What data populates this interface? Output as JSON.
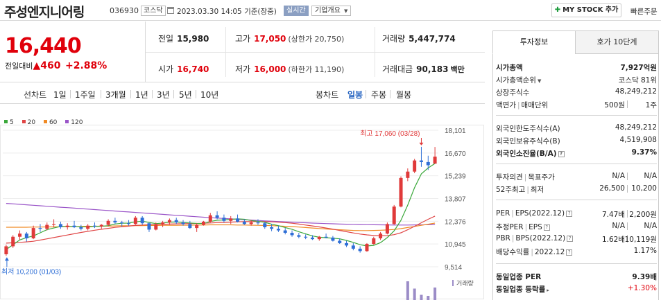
{
  "header": {
    "company_name": "주성엔지니어링",
    "code": "036930",
    "market": "코스닥",
    "datetime": "2023.03.30 14:05",
    "basis": "기준(장중)",
    "realtime_label": "실시간",
    "company_overview_label": "기업개요",
    "my_stock_label": "MY STOCK 추가",
    "quick_order_label": "빠른주문"
  },
  "price": {
    "current": "16,440",
    "change_label": "전일대비",
    "change_amount": "460",
    "change_percent": "+2.88%"
  },
  "stats": {
    "prev_label": "전일",
    "prev_value": "15,980",
    "high_label": "고가",
    "high_value": "17,050",
    "upper_limit": "(상한가 20,750)",
    "volume_label": "거래량",
    "volume_value": "5,447,774",
    "open_label": "시가",
    "open_value": "16,740",
    "low_label": "저가",
    "low_value": "16,000",
    "lower_limit": "(하한가 11,190)",
    "amount_label": "거래대금",
    "amount_value": "90,183",
    "amount_unit": "백만"
  },
  "period": {
    "line_chart_label": "선차트",
    "line_periods": [
      "1일",
      "1주일",
      "3개월",
      "1년",
      "3년",
      "5년",
      "10년"
    ],
    "candle_chart_label": "봉차트",
    "candle_periods": [
      "일봉",
      "주봉",
      "월봉"
    ],
    "selected": "일봉"
  },
  "chart_data": {
    "type": "candlestick",
    "legend": [
      "5",
      "20",
      "60",
      "120"
    ],
    "legend_colors": [
      "#3aa83a",
      "#e04545",
      "#f08a24",
      "#9a55c8"
    ],
    "y_ticks": [
      "18,101",
      "16,670",
      "15,239",
      "13,807",
      "12,376",
      "10,945",
      "9,514"
    ],
    "ylim": [
      9514,
      18101
    ],
    "high_annotation": "최고 17,060 (03/28)",
    "low_annotation": "최저 10,200 (01/03)",
    "volume_label": "거래량",
    "candles": [
      [
        10300,
        10900,
        10200,
        10800
      ],
      [
        10800,
        11500,
        10700,
        11400
      ],
      [
        11400,
        11800,
        11200,
        11600
      ],
      [
        11600,
        11700,
        11100,
        11300
      ],
      [
        11300,
        12100,
        11250,
        11950
      ],
      [
        11950,
        12200,
        11700,
        11900
      ],
      [
        11900,
        12300,
        11800,
        12150
      ],
      [
        12150,
        12500,
        12000,
        12200
      ],
      [
        12200,
        12350,
        11900,
        12000
      ],
      [
        12000,
        12250,
        11850,
        12100
      ],
      [
        12100,
        12400,
        11950,
        12000
      ],
      [
        12000,
        12150,
        11800,
        11900
      ],
      [
        11900,
        12200,
        11800,
        12100
      ],
      [
        12100,
        12300,
        11950,
        12050
      ],
      [
        12050,
        12200,
        11900,
        12150
      ],
      [
        12150,
        12500,
        12050,
        12400
      ],
      [
        12400,
        12600,
        12200,
        12300
      ],
      [
        12300,
        12400,
        12050,
        12250
      ],
      [
        12250,
        12450,
        12100,
        12200
      ],
      [
        12200,
        12700,
        12150,
        12600
      ],
      [
        12600,
        12700,
        12150,
        12250
      ],
      [
        12250,
        12300,
        11700,
        11850
      ],
      [
        11850,
        12300,
        11800,
        12200
      ],
      [
        12200,
        12400,
        12000,
        12300
      ],
      [
        12300,
        12550,
        12150,
        12450
      ],
      [
        12450,
        12600,
        12200,
        12300
      ],
      [
        12300,
        12450,
        12100,
        12200
      ],
      [
        12200,
        12400,
        11900,
        11950
      ],
      [
        11950,
        12250,
        11700,
        12150
      ],
      [
        12150,
        12400,
        12100,
        12350
      ],
      [
        12350,
        12900,
        12300,
        12750
      ],
      [
        12750,
        13000,
        12500,
        12600
      ],
      [
        12600,
        12800,
        12300,
        12400
      ],
      [
        12400,
        12700,
        12200,
        12550
      ],
      [
        12550,
        12800,
        12300,
        12350
      ],
      [
        12350,
        12500,
        12150,
        12200
      ],
      [
        12200,
        12450,
        12100,
        12300
      ],
      [
        12300,
        12500,
        12150,
        12250
      ],
      [
        12250,
        12350,
        11900,
        12000
      ],
      [
        12000,
        12200,
        11750,
        11900
      ],
      [
        11900,
        12100,
        11700,
        11800
      ],
      [
        11800,
        11950,
        11550,
        11650
      ],
      [
        11650,
        11800,
        11400,
        11500
      ],
      [
        11500,
        11650,
        11300,
        11400
      ],
      [
        11400,
        11550,
        11250,
        11350
      ],
      [
        11350,
        11500,
        11200,
        11250
      ],
      [
        11250,
        11450,
        11150,
        11400
      ],
      [
        11400,
        11600,
        11300,
        11350
      ],
      [
        11350,
        11450,
        11100,
        11150
      ],
      [
        11150,
        11300,
        10950,
        11000
      ],
      [
        11000,
        11150,
        10750,
        10850
      ],
      [
        10850,
        11000,
        10550,
        10650
      ],
      [
        10650,
        10800,
        10400,
        10500
      ],
      [
        10500,
        11000,
        10450,
        10950
      ],
      [
        10950,
        11400,
        10900,
        11300
      ],
      [
        11300,
        11700,
        11200,
        11600
      ],
      [
        11600,
        12300,
        11550,
        12200
      ],
      [
        12200,
        13400,
        12150,
        13300
      ],
      [
        13300,
        15200,
        13250,
        15100
      ],
      [
        15100,
        15700,
        14900,
        15500
      ],
      [
        15500,
        16300,
        15400,
        16200
      ],
      [
        16200,
        17060,
        15800,
        16100
      ],
      [
        16100,
        16500,
        15600,
        15900
      ],
      [
        16000,
        17050,
        16000,
        16440
      ]
    ],
    "ma5": [
      10600,
      10900,
      11200,
      11350,
      11450,
      11650,
      11850,
      11950,
      12050,
      12050,
      12050,
      12030,
      12020,
      12050,
      12060,
      12100,
      12200,
      12250,
      12260,
      12340,
      12380,
      12300,
      12230,
      12260,
      12320,
      12330,
      12300,
      12270,
      12240,
      12230,
      12360,
      12440,
      12460,
      12490,
      12530,
      12500,
      12420,
      12370,
      12310,
      12190,
      12100,
      11980,
      11870,
      11720,
      11580,
      11450,
      11370,
      11340,
      11310,
      11270,
      11170,
      11050,
      10900,
      10820,
      10860,
      11030,
      11350,
      11770,
      12430,
      13390,
      14490,
      15360,
      15730,
      16010
    ],
    "ma20": [
      11000,
      11020,
      11050,
      11080,
      11120,
      11190,
      11270,
      11350,
      11430,
      11510,
      11590,
      11670,
      11740,
      11810,
      11870,
      11930,
      11990,
      12030,
      12070,
      12110,
      12140,
      12160,
      12170,
      12180,
      12200,
      12210,
      12220,
      12230,
      12240,
      12250,
      12270,
      12290,
      12300,
      12320,
      12340,
      12350,
      12350,
      12360,
      12350,
      12340,
      12320,
      12290,
      12250,
      12200,
      12140,
      12080,
      12020,
      11950,
      11880,
      11800,
      11720,
      11640,
      11570,
      11520,
      11480,
      11460,
      11470,
      11530,
      11650,
      11840,
      12060,
      12280,
      12500,
      12700
    ],
    "ma60": [
      12000,
      12000,
      12000,
      12000,
      12010,
      12010,
      12020,
      12020,
      12030,
      12040,
      12040,
      12050,
      12060,
      12060,
      12070,
      12070,
      12080,
      12090,
      12090,
      12100,
      12100,
      12110,
      12110,
      12120,
      12120,
      12120,
      12130,
      12130,
      12140,
      12140,
      12150,
      12150,
      12150,
      12150,
      12140,
      12140,
      12130,
      12120,
      12110,
      12100,
      12080,
      12060,
      12040,
      12010,
      11980,
      11950,
      11920,
      11890,
      11860,
      11840,
      11820,
      11800,
      11790,
      11790,
      11800,
      11810,
      11830,
      11860,
      11910,
      11980,
      12050,
      12120,
      12190,
      12260
    ],
    "ma120": [
      13500,
      13470,
      13440,
      13410,
      13380,
      13350,
      13320,
      13290,
      13260,
      13230,
      13200,
      13170,
      13140,
      13110,
      13080,
      13050,
      13020,
      12990,
      12960,
      12930,
      12900,
      12870,
      12840,
      12810,
      12780,
      12750,
      12720,
      12690,
      12660,
      12630,
      12600,
      12575,
      12550,
      12525,
      12500,
      12475,
      12450,
      12425,
      12400,
      12380,
      12360,
      12340,
      12320,
      12300,
      12280,
      12260,
      12245,
      12230,
      12215,
      12200,
      12190,
      12180,
      12170,
      12160,
      12155,
      12150,
      12145,
      12140,
      12140,
      12140,
      12145,
      12150,
      12160,
      12170
    ],
    "volume_recent": [
      0.9,
      0.55,
      0.25,
      0.2,
      0.6
    ]
  },
  "right_panel": {
    "tab_invest": "투자정보",
    "tab_hoga": "호가 10단계",
    "rows": {
      "mcap_label": "시가총액",
      "mcap_value": "7,927억원",
      "mcap_rank_label": "시가총액순위",
      "mcap_rank_value": "코스닥 81위",
      "shares_label": "상장주식수",
      "shares_value": "48,249,212",
      "par_label": "액면가",
      "unit_label": "매매단위",
      "par_value": "500원",
      "unit_value": "1주",
      "foreign_limit_label": "외국인한도주식수(A)",
      "foreign_limit_value": "48,249,212",
      "foreign_hold_label": "외국인보유주식수(B)",
      "foreign_hold_value": "4,519,908",
      "foreign_ratio_label": "외국인소진율(B/A)",
      "foreign_ratio_value": "9.37%",
      "opinion_label": "투자의견",
      "target_label": "목표주가",
      "opinion_value": "N/A",
      "target_value": "N/A",
      "w52_high_label": "52주최고",
      "w52_low_label": "최저",
      "w52_high_value": "26,500",
      "w52_low_value": "10,200",
      "per_label": "PER",
      "eps_label": "EPS(2022.12)",
      "per_value": "7.47배",
      "eps_value": "2,200원",
      "est_per_label": "추정PER",
      "est_eps_label": "EPS",
      "est_per_value": "N/A",
      "est_eps_value": "N/A",
      "pbr_label": "PBR",
      "bps_label": "BPS(2022.12)",
      "pbr_value": "1.62배",
      "bps_value": "10,119원",
      "div_label": "배당수익률",
      "div_date": "2022.12",
      "div_value": "1.17%",
      "ind_per_label": "동일업종 PER",
      "ind_per_value": "9.39배",
      "ind_rate_label": "동일업종 등락률",
      "ind_rate_value": "+1.30%"
    }
  }
}
